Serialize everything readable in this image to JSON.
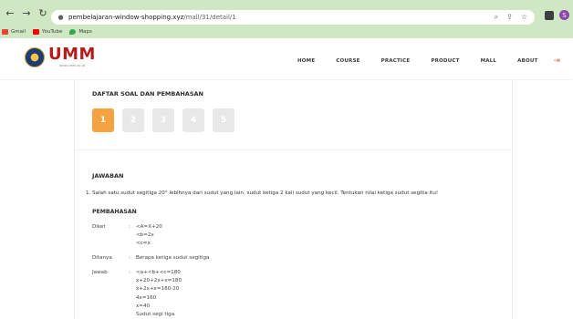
{
  "browser": {
    "url_host": "pembelajaran-window-shopping.xyz",
    "url_path": "/mall/31/detail/1",
    "avatar_letter": "S",
    "bookmarks": [
      {
        "label": "Gmail",
        "color": "#ea4335"
      },
      {
        "label": "YouTube",
        "color": "#ff0000"
      },
      {
        "label": "Maps",
        "color": "#34a853"
      }
    ]
  },
  "site": {
    "logo_text": "UMM",
    "logo_sub": "www.umm.ac.id",
    "menu": [
      "HOME",
      "COURSE",
      "PRACTICE",
      "PRODUCT",
      "MALL",
      "ABOUT"
    ],
    "accent": "#f4a340",
    "brand_red": "#b71c1c"
  },
  "quiz": {
    "section_title": "DAFTAR SOAL DAN PEMBAHASAN",
    "numbers": [
      "1",
      "2",
      "3",
      "4",
      "5"
    ],
    "active_number": "1"
  },
  "answer": {
    "title": "JAWABAN",
    "question": "1. Salah satu sudut segitiga 20° lebihnya dari sudut yang lain, sudut ketiga 2 kali sudut yang kecil. Tentukan nilai ketiga sudut segitia itu!",
    "pembahasan_title": "PEMBAHASAN",
    "diket_label": "Diket",
    "diket_lines": [
      "<A=X+20",
      "<b=2x",
      "<c=x"
    ],
    "ditanya_label": "Ditanya",
    "ditanya_lines": [
      "Berapa ketiga sudut segitiga"
    ],
    "jawab_label": "Jawab",
    "jawab_lines": [
      "<a+<b+<c=180",
      "x+20+2x+x=180",
      "x+2x+x=180-20",
      "4x=160",
      "x=40",
      "Sudut segi tiga"
    ],
    "colon": ":"
  }
}
